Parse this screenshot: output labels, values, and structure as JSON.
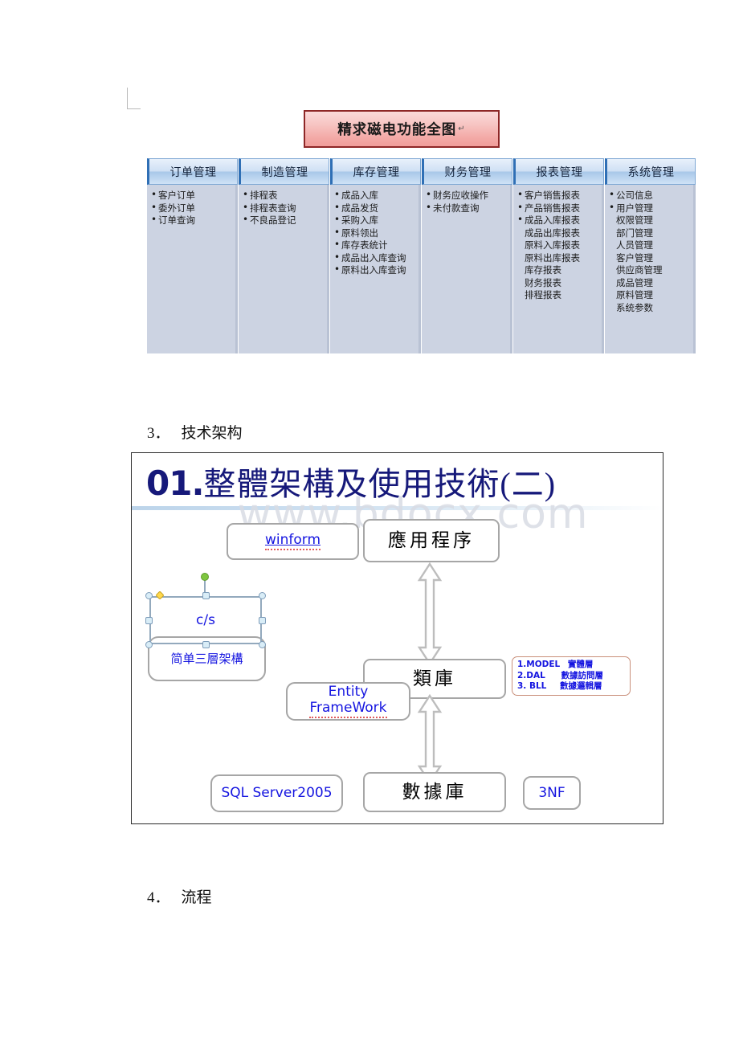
{
  "document": {
    "sections": [
      {
        "number": "3．",
        "title": "技术架构"
      },
      {
        "number": "4．",
        "title": "流程"
      }
    ]
  },
  "figure1": {
    "title": "精求磁电功能全图",
    "title_mark": "↵",
    "columns": [
      {
        "header": "订单管理",
        "items": [
          {
            "text": "客户订单",
            "bullet": true
          },
          {
            "text": "委外订单",
            "bullet": true
          },
          {
            "text": "订单查询",
            "bullet": true
          }
        ]
      },
      {
        "header": "制造管理",
        "items": [
          {
            "text": "排程表",
            "bullet": true
          },
          {
            "text": "排程表查询",
            "bullet": true
          },
          {
            "text": "不良品登记",
            "bullet": true
          }
        ]
      },
      {
        "header": "库存管理",
        "items": [
          {
            "text": "成品入库",
            "bullet": true
          },
          {
            "text": "成品发货",
            "bullet": true
          },
          {
            "text": "采购入库",
            "bullet": true
          },
          {
            "text": "原料领出",
            "bullet": true
          },
          {
            "text": "库存表统计",
            "bullet": true
          },
          {
            "text": "成品出入库查询",
            "bullet": true
          },
          {
            "text": "原料出入库查询",
            "bullet": true
          }
        ]
      },
      {
        "header": "财务管理",
        "items": [
          {
            "text": "财务应收操作",
            "bullet": true
          },
          {
            "text": "未付款查询",
            "bullet": true
          }
        ]
      },
      {
        "header": "报表管理",
        "items": [
          {
            "text": "客户销售报表",
            "bullet": true
          },
          {
            "text": "产品销售报表",
            "bullet": true
          },
          {
            "text": "成品入库报表",
            "bullet": true
          },
          {
            "text": "成品出库报表",
            "bullet": false
          },
          {
            "text": "原料入库报表",
            "bullet": false
          },
          {
            "text": "原料出库报表",
            "bullet": false
          },
          {
            "text": "库存报表",
            "bullet": false
          },
          {
            "text": "财务报表",
            "bullet": false
          },
          {
            "text": "排程报表",
            "bullet": false
          }
        ]
      },
      {
        "header": "系统管理",
        "items": [
          {
            "text": "公司信息",
            "bullet": true
          },
          {
            "text": "用户管理",
            "bullet": true
          },
          {
            "text": "权限管理",
            "bullet": false
          },
          {
            "text": "部门管理",
            "bullet": false
          },
          {
            "text": "人员管理",
            "bullet": false
          },
          {
            "text": "客户管理",
            "bullet": false
          },
          {
            "text": "供应商管理",
            "bullet": false
          },
          {
            "text": "成品管理",
            "bullet": false
          },
          {
            "text": "原料管理",
            "bullet": false
          },
          {
            "text": "系统参数",
            "bullet": false
          }
        ]
      }
    ]
  },
  "figure2": {
    "slide_number": "01.",
    "slide_title": "整體架構及使用技術(二)",
    "watermark": "www.bdocx.com",
    "boxes": {
      "winform": "winform",
      "app": "應用程序",
      "cs": "c/s",
      "three_tier": "简单三層架構",
      "class_lib": "類庫",
      "entity_framework_line1": "Entity",
      "entity_framework_line2": "FrameWork",
      "sql_server": "SQL Server2005",
      "database": "數據庫",
      "nf": "3NF"
    },
    "note_lines": [
      {
        "no": "1.MODEL",
        "name": "實體層"
      },
      {
        "no": "2.DAL",
        "name": "數據訪問層"
      },
      {
        "no": "3. BLL",
        "name": "數據邏輯層"
      }
    ]
  },
  "colors": {
    "title_box_border": "#8e2727",
    "title_box_fill": "#f3aaa7",
    "column_header_accent": "#2f6fb5",
    "column_body": "#ccd3e2",
    "slide_title": "#16197a",
    "slide_blue_text": "#1515e0",
    "note_border": "#c98f7a",
    "arrow_gray": "#bdbdbd"
  }
}
